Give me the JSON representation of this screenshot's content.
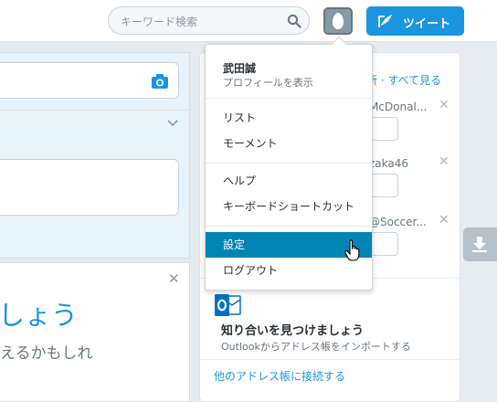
{
  "topbar": {
    "search_placeholder": "キーワード検索",
    "tweet_label": "ツイート"
  },
  "left": {
    "heading": "しょう",
    "subheading": "えるかもしれ"
  },
  "right": {
    "wtf_links": "新 · すべて見る",
    "suggestions": [
      {
        "handle": "McDonal..."
      },
      {
        "handle": "zaka46"
      },
      {
        "handle": "@Soccer..."
      }
    ],
    "find_title": "知り合いを見つけましょう",
    "find_sub": "Outlookからアドレス帳をインポートする",
    "other_link": "他のアドレス帳に接続する"
  },
  "menu": {
    "user_name": "武田誠",
    "view_profile": "プロフィールを表示",
    "items": [
      {
        "label": "リスト"
      },
      {
        "label": "モーメント"
      },
      {
        "label": "ヘルプ"
      },
      {
        "label": "キーボードショートカット"
      },
      {
        "label": "設定"
      },
      {
        "label": "ログアウト"
      }
    ]
  },
  "colors": {
    "brand": "#1b95e0",
    "menu_active": "#0084b4"
  }
}
